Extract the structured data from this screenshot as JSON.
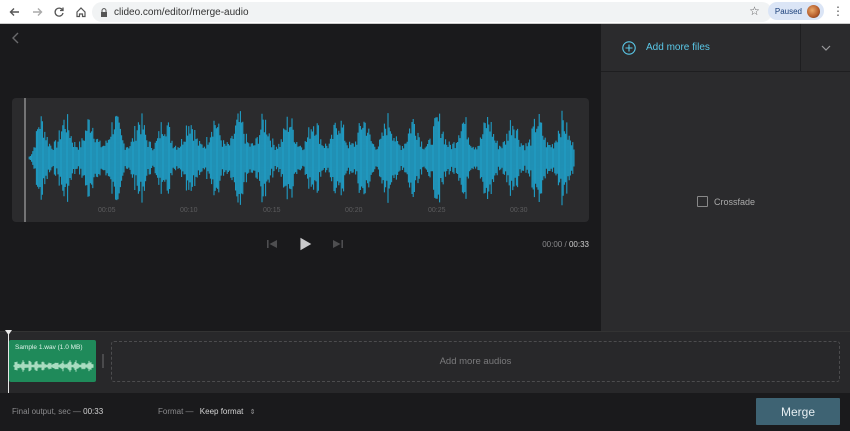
{
  "browser": {
    "url": "clideo.com/editor/merge-audio",
    "paused_label": "Paused"
  },
  "player": {
    "ticks": [
      "00:05",
      "00:10",
      "00:15",
      "00:20",
      "00:25",
      "00:30"
    ],
    "time_current": "00:00",
    "time_separator": "/",
    "time_total": "00:33"
  },
  "sidebar": {
    "add_more_files": "Add more files",
    "crossfade_label": "Crossfade",
    "crossfade_checked": false
  },
  "timeline": {
    "clip_name": "Sample 1.wav (1.0 MB)",
    "add_more_audios": "Add more audios"
  },
  "footer": {
    "final_output_label": "Final output, sec —",
    "final_output_value": "00:33",
    "format_label": "Format —",
    "format_value": "Keep format",
    "merge_label": "Merge"
  },
  "colors": {
    "waveform": "#1f9fc8",
    "clip": "#1f8a5a",
    "accent": "#5ac8e8",
    "merge_button": "#3e6373"
  }
}
